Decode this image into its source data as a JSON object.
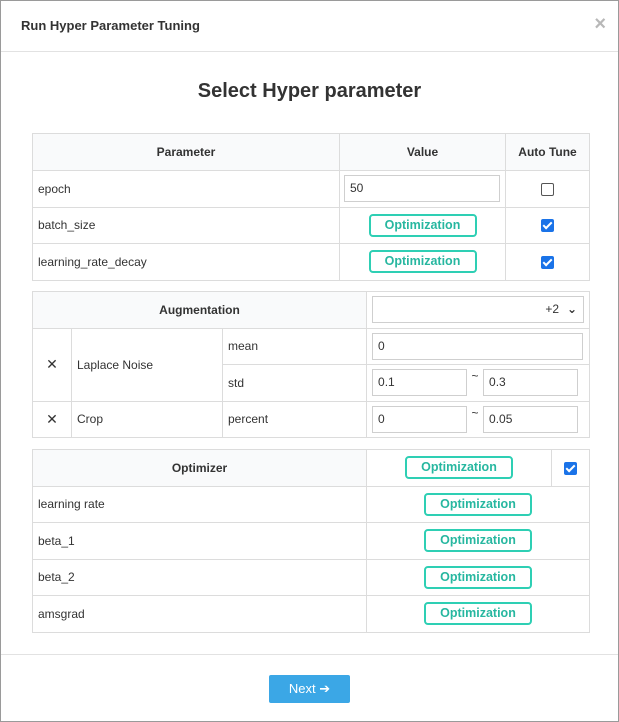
{
  "dialog": {
    "title": "Run Hyper Parameter Tuning",
    "close_glyph": "×"
  },
  "heading": "Select Hyper parameter",
  "params_table": {
    "headers": [
      "Parameter",
      "Value",
      "Auto Tune"
    ],
    "rows": [
      {
        "name": "epoch",
        "value": "50",
        "auto_tune": false
      },
      {
        "name": "batch_size",
        "button": "Optimization",
        "auto_tune": true
      },
      {
        "name": "learning_rate_decay",
        "button": "Optimization",
        "auto_tune": true
      }
    ]
  },
  "augmentation": {
    "header": "Augmentation",
    "select_value": "+2",
    "items": [
      {
        "remove": "✕",
        "name": "Laplace Noise",
        "fields": [
          {
            "label": "mean",
            "value": "0"
          },
          {
            "label": "std",
            "from": "0.1",
            "tilde": "~",
            "to": "0.3"
          }
        ]
      },
      {
        "remove": "✕",
        "name": "Crop",
        "fields": [
          {
            "label": "percent",
            "from": "0",
            "tilde": "~",
            "to": "0.05"
          }
        ]
      }
    ]
  },
  "optimizer": {
    "header": "Optimizer",
    "button": "Optimization",
    "auto_tune": true,
    "rows": [
      {
        "name": "learning rate",
        "button": "Optimization"
      },
      {
        "name": "beta_1",
        "button": "Optimization"
      },
      {
        "name": "beta_2",
        "button": "Optimization"
      },
      {
        "name": "amsgrad",
        "button": "Optimization"
      }
    ]
  },
  "footer": {
    "next_label": "Next ➔"
  },
  "colors": {
    "accent": "#2ecfb4",
    "primary": "#3ba7e6",
    "checkbox": "#1a73e8"
  }
}
